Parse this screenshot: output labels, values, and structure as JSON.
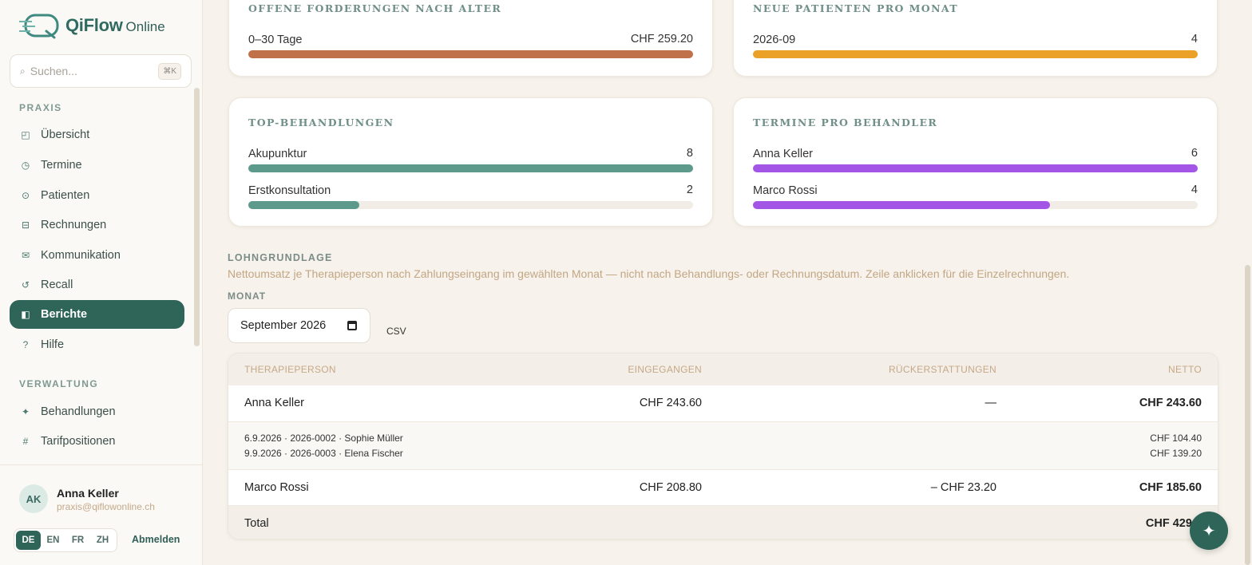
{
  "app": {
    "name": "QiFlow",
    "name_suffix": "Online"
  },
  "search": {
    "placeholder": "Suchen...",
    "shortcut": "⌘K"
  },
  "sidebar": {
    "section_praxis": "PRAXIS",
    "praxis_items": [
      {
        "label": "Übersicht",
        "icon": "dashboard-icon"
      },
      {
        "label": "Termine",
        "icon": "clock-icon"
      },
      {
        "label": "Patienten",
        "icon": "user-icon"
      },
      {
        "label": "Rechnungen",
        "icon": "invoice-icon"
      },
      {
        "label": "Kommunikation",
        "icon": "mail-icon"
      },
      {
        "label": "Recall",
        "icon": "recall-icon"
      },
      {
        "label": "Berichte",
        "icon": "reports-icon",
        "active": true
      },
      {
        "label": "Hilfe",
        "icon": "help-icon"
      }
    ],
    "section_verwaltung": "VERWALTUNG",
    "verwaltung_items": [
      {
        "label": "Behandlungen",
        "icon": "sparkle-icon"
      },
      {
        "label": "Tarifpositionen",
        "icon": "hash-icon"
      }
    ]
  },
  "user": {
    "initials": "AK",
    "name": "Anna Keller",
    "email": "praxis@qiflowonline.ch"
  },
  "languages": [
    "DE",
    "EN",
    "FR",
    "ZH"
  ],
  "active_language": "DE",
  "logout_label": "Abmelden",
  "cards": {
    "open_claims": {
      "title": "OFFENE FORDERUNGEN NACH ALTER",
      "rows": [
        {
          "label": "0–30 Tage",
          "value": "CHF 259.20",
          "fraction": 1.0
        }
      ],
      "color": "#c0714a"
    },
    "new_patients": {
      "title": "NEUE PATIENTEN PRO MONAT",
      "rows": [
        {
          "label": "2026-09",
          "value": "4",
          "fraction": 1.0
        }
      ],
      "color": "#eba127"
    },
    "top_treatments": {
      "title": "TOP-BEHANDLUNGEN",
      "rows": [
        {
          "label": "Akupunktur",
          "value": "8",
          "fraction": 1.0
        },
        {
          "label": "Erstkonsultation",
          "value": "2",
          "fraction": 0.25
        }
      ],
      "color": "#5e9a8c"
    },
    "appointments_per_therapist": {
      "title": "TERMINE PRO BEHANDLER",
      "rows": [
        {
          "label": "Anna Keller",
          "value": "6",
          "fraction": 1.0
        },
        {
          "label": "Marco Rossi",
          "value": "4",
          "fraction": 0.667
        }
      ],
      "color": "#a356e6"
    }
  },
  "payroll": {
    "heading": "LOHNGRUNDLAGE",
    "description": "Nettoumsatz je Therapieperson nach Zahlungseingang im gewählten Monat — nicht nach Behandlungs- oder Rechnungsdatum. Zeile anklicken für die Einzelrechnungen.",
    "month_label": "MONAT",
    "month_value": "September 2026",
    "csv_label": "CSV",
    "columns": [
      "THERAPIEPERSON",
      "EINGEGANGEN",
      "RÜCKERSTATTUNGEN",
      "NETTO"
    ],
    "rows": [
      {
        "person": "Anna Keller",
        "received": "CHF 243.60",
        "refunds": "—",
        "net": "CHF 243.60"
      },
      {
        "person": "Marco Rossi",
        "received": "CHF 208.80",
        "refunds": "– CHF 23.20",
        "net": "CHF 185.60"
      }
    ],
    "details": [
      {
        "text": "6.9.2026 · 2026-0002 · Sophie Müller",
        "amount": "CHF 104.40"
      },
      {
        "text": "9.9.2026 · 2026-0003 · Elena Fischer",
        "amount": "CHF 139.20"
      }
    ],
    "total_label": "Total",
    "total_value": "CHF 429.2"
  }
}
